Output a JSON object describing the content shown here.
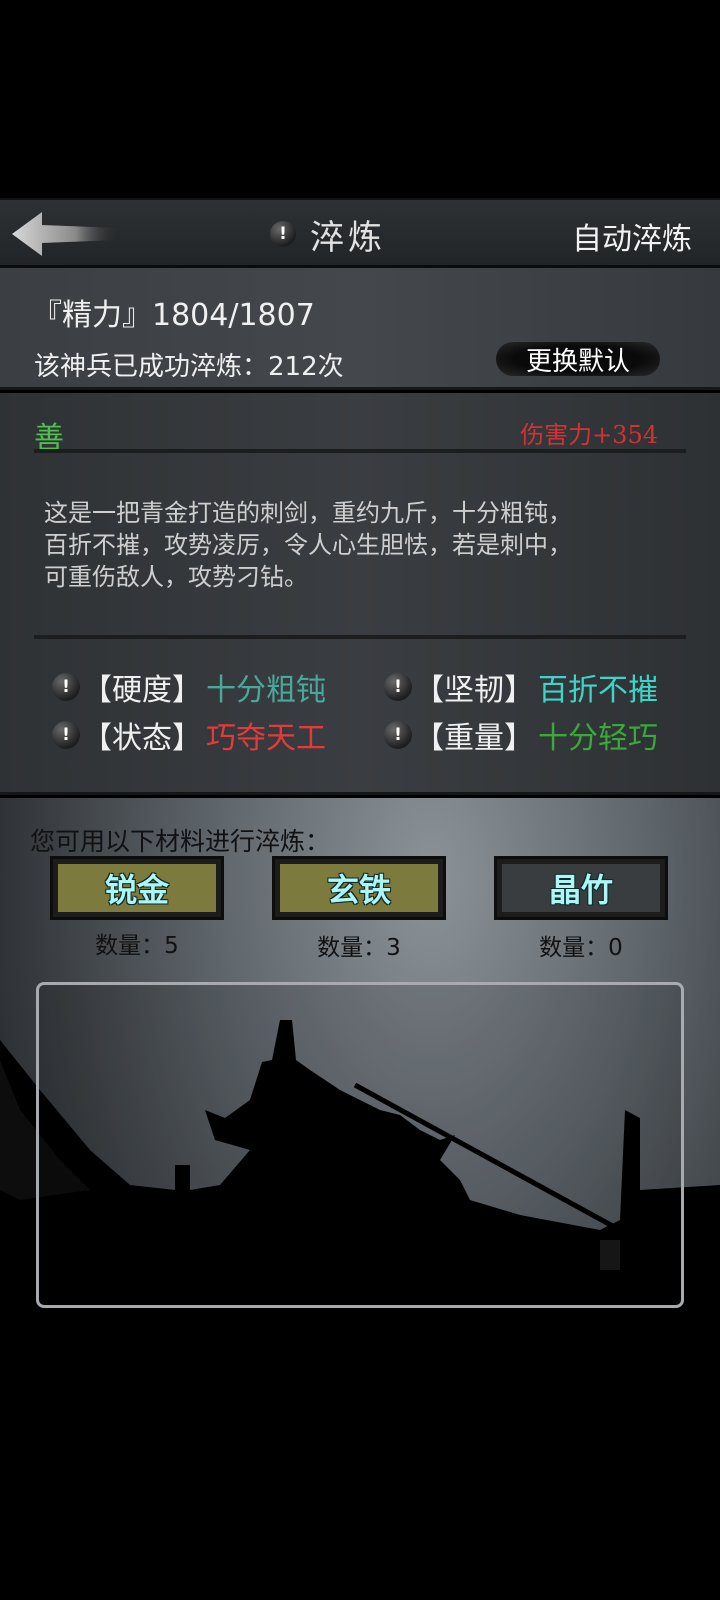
{
  "header": {
    "title": "淬炼",
    "auto_label": "自动淬炼"
  },
  "status": {
    "energy": "『精力』1804/1807",
    "refined": "该神兵已成功淬炼：212次",
    "change_label": "更换默认"
  },
  "weapon": {
    "alignment": "善",
    "damage": "伤害力+354",
    "description": "这是一把青金打造的刺剑，重约九斤，十分粗钝，\n百折不摧，攻势凌厉，令人心生胆怯，若是刺中，\n可重伤敌人，攻势刁钻。"
  },
  "attributes": [
    {
      "label": "【硬度】",
      "value": "十分粗钝",
      "color": "#4aa79b"
    },
    {
      "label": "【坚韧】",
      "value": "百折不摧",
      "color": "#3fd4c8"
    },
    {
      "label": "【状态】",
      "value": "巧夺天工",
      "color": "#e63a3a"
    },
    {
      "label": "【重量】",
      "value": "十分轻巧",
      "color": "#3aa83a"
    }
  ],
  "materials": {
    "prompt": "您可用以下材料进行淬炼：",
    "items": [
      {
        "name": "锐金",
        "count": "数量：5",
        "bg": "#7c7a3c"
      },
      {
        "name": "玄铁",
        "count": "数量：3",
        "bg": "#7c7a3c"
      },
      {
        "name": "晶竹",
        "count": "数量：0",
        "bg": "#3a3d40"
      }
    ]
  },
  "icons": {
    "back": "back-arrow-icon",
    "info": "info-icon"
  }
}
